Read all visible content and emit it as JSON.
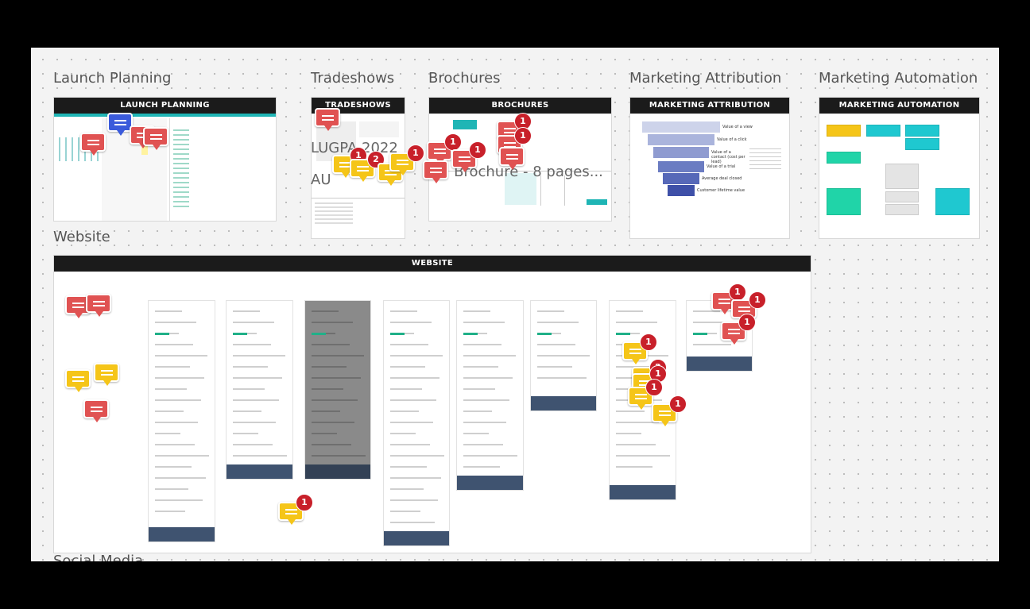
{
  "board": {
    "frames": [
      {
        "title": "Launch Planning",
        "header": "LAUNCH PLANNING"
      },
      {
        "title": "Tradeshows",
        "header": "TRADESHOWS",
        "overlay_text": [
          "LUGPA 2022",
          "AU"
        ]
      },
      {
        "title": "Brochures",
        "header": "BROCHURES",
        "overlay_text": "n Brochure - 8 pages..."
      },
      {
        "title": "Marketing Attribution",
        "header": "MARKETING ATTRIBUTION",
        "funnel_labels": [
          "Value of a view",
          "Value of a click",
          "Value of a contact (cost per lead)",
          "Value of a trial",
          "Average deal closed",
          "Customer lifetime value"
        ]
      },
      {
        "title": "Marketing Automation",
        "header": "MARKETING AUTOMATION"
      },
      {
        "title": "Website",
        "header": "WEBSITE"
      }
    ],
    "next_section_title": "Social Media"
  },
  "colors": {
    "comment_red": "#e05252",
    "comment_yellow": "#f5c518",
    "comment_blue": "#3b5bdb",
    "badge": "#c8202a",
    "frame_header": "#1b1b1b",
    "teal": "#1fc8c8",
    "green": "#20c997",
    "navy": "#3f5370"
  },
  "comments": [
    {
      "color": "blue",
      "count": null
    },
    {
      "color": "red",
      "count": null
    },
    {
      "color": "red",
      "count": null
    },
    {
      "color": "red",
      "count": null
    },
    {
      "color": "red",
      "count": null
    },
    {
      "color": "yellow",
      "count": "1"
    },
    {
      "color": "yellow",
      "count": "2"
    },
    {
      "color": "yellow",
      "count": "1"
    },
    {
      "color": "yellow",
      "count": "1"
    },
    {
      "color": "red",
      "count": "1"
    },
    {
      "color": "red",
      "count": null
    },
    {
      "color": "red",
      "count": "1"
    },
    {
      "color": "red",
      "count": "1"
    },
    {
      "color": "red",
      "count": "1"
    },
    {
      "color": "red",
      "count": null
    },
    {
      "color": "red",
      "count": null
    },
    {
      "color": "red",
      "count": null
    },
    {
      "color": "yellow",
      "count": null
    },
    {
      "color": "yellow",
      "count": null
    },
    {
      "color": "red",
      "count": null
    },
    {
      "color": "yellow",
      "count": "1"
    },
    {
      "color": "yellow",
      "count": "1"
    },
    {
      "color": "yellow",
      "count": "2"
    },
    {
      "color": "yellow",
      "count": "1"
    },
    {
      "color": "yellow",
      "count": "1"
    },
    {
      "color": "yellow",
      "count": "1"
    },
    {
      "color": "red",
      "count": "1"
    },
    {
      "color": "red",
      "count": "1"
    },
    {
      "color": "red",
      "count": "1"
    }
  ]
}
